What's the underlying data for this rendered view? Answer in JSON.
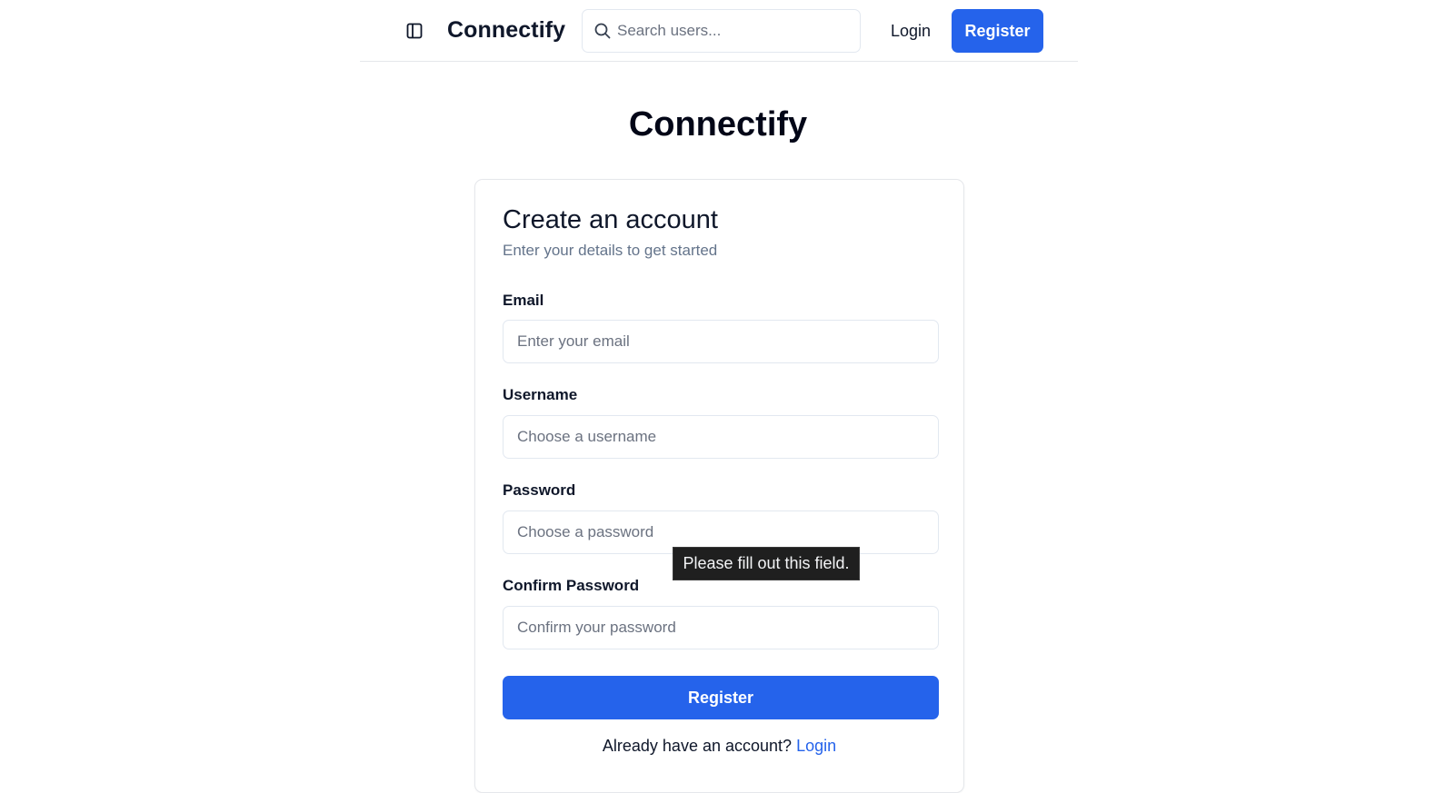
{
  "header": {
    "brand": "Connectify",
    "search_placeholder": "Search users...",
    "login_label": "Login",
    "register_label": "Register"
  },
  "hero": {
    "title": "Connectify"
  },
  "form": {
    "title": "Create an account",
    "subtitle": "Enter your details to get started",
    "email": {
      "label": "Email",
      "placeholder": "Enter your email",
      "value": ""
    },
    "username": {
      "label": "Username",
      "placeholder": "Choose a username",
      "value": ""
    },
    "password": {
      "label": "Password",
      "placeholder": "Choose a password",
      "value": ""
    },
    "confirm_password": {
      "label": "Confirm Password",
      "placeholder": "Confirm your password",
      "value": ""
    },
    "submit_label": "Register",
    "footer_text": "Already have an account?",
    "footer_link": "Login"
  },
  "validation_tooltip": {
    "text": "Please fill out this field."
  },
  "colors": {
    "accent": "#2563eb",
    "text": "#0f172a",
    "muted": "#64748b",
    "border": "#e2e8f0",
    "tooltip_bg": "#1f1f1f"
  },
  "icons": {
    "sidebar_toggle": "panel-left-icon",
    "search": "search-icon"
  }
}
